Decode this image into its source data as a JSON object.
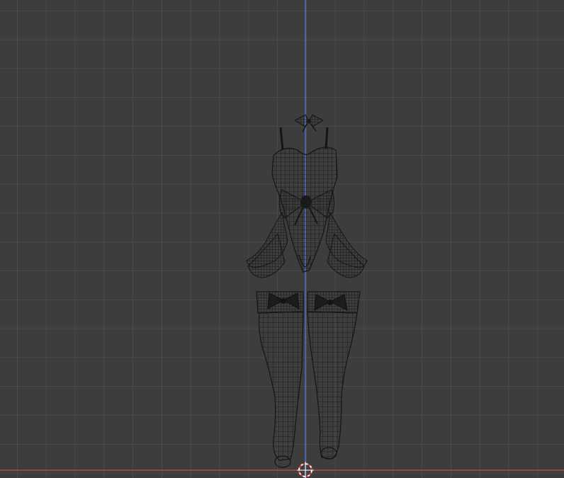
{
  "viewport": {
    "view": "front-orthographic",
    "shading": "wireframe",
    "background_color": "#3d3d3d",
    "grid_minor_color": "#4a4a4a",
    "grid_major_color": "#565656",
    "wire_color": "#111111",
    "z_axis_color": "#4c72c6",
    "x_axis_color": "#c94848",
    "cursor_colors": [
      "#ffffff",
      "#e03a3a"
    ]
  },
  "scene": {
    "objects": [
      {
        "name": "hair-bow",
        "icon": "bow"
      },
      {
        "name": "corset-bodysuit",
        "icon": "garment"
      },
      {
        "name": "peplum-ruffles",
        "icon": "ruffle"
      },
      {
        "name": "waist-bow",
        "icon": "bow"
      },
      {
        "name": "stocking-left",
        "icon": "stocking"
      },
      {
        "name": "stocking-right",
        "icon": "stocking"
      }
    ]
  },
  "cursor": {
    "icon": "3d-cursor-icon"
  }
}
